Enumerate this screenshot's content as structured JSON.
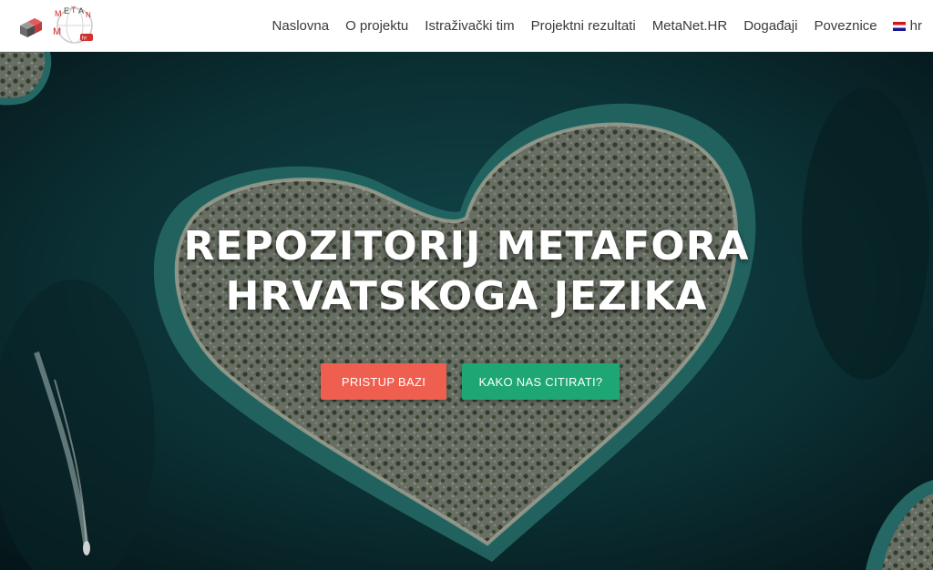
{
  "nav": {
    "items": [
      {
        "label": "Naslovna"
      },
      {
        "label": "O projektu"
      },
      {
        "label": "Istraživački tim"
      },
      {
        "label": "Projektni rezultati"
      },
      {
        "label": "MetaNet.HR"
      },
      {
        "label": "Događaji"
      },
      {
        "label": "Poveznice"
      }
    ],
    "language": "hr",
    "logo_text": "METANET.hr"
  },
  "hero": {
    "title_line1": "REPOZITORIJ METAFORA",
    "title_line2": "HRVATSKOGA JEZIKA",
    "primary_button": "PRISTUP BAZI",
    "secondary_button": "KAKO NAS CITIRATI?"
  },
  "colors": {
    "primary_button": "#ef5f4f",
    "secondary_button": "#1ea774",
    "sea": "#0e3b40",
    "island": "#7d8478"
  },
  "icons": [
    "logo",
    "croatian-flag-icon"
  ]
}
